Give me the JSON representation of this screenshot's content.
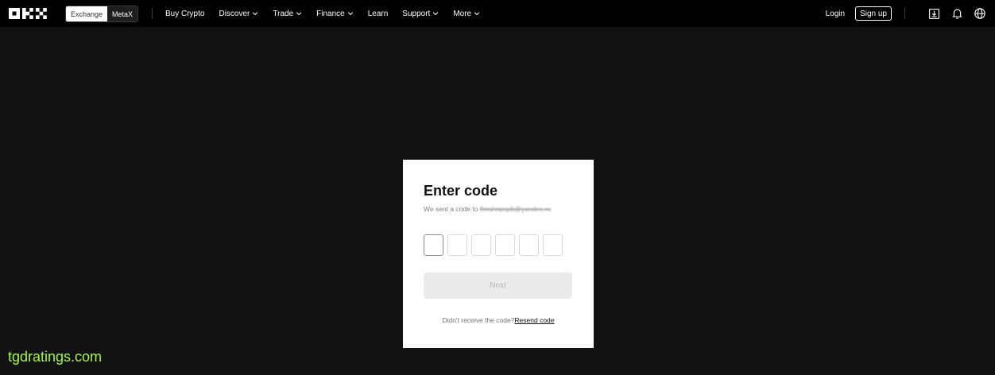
{
  "header": {
    "switcher": {
      "active_label": "Exchange",
      "inactive_label": "MetaX"
    },
    "nav": [
      {
        "label": "Buy Crypto",
        "has_dropdown": false
      },
      {
        "label": "Discover",
        "has_dropdown": true
      },
      {
        "label": "Trade",
        "has_dropdown": true
      },
      {
        "label": "Finance",
        "has_dropdown": true
      },
      {
        "label": "Learn",
        "has_dropdown": false
      },
      {
        "label": "Support",
        "has_dropdown": true
      },
      {
        "label": "More",
        "has_dropdown": true
      }
    ],
    "login_label": "Login",
    "signup_label": "Sign up",
    "icons": [
      "download-icon",
      "bell-icon",
      "globe-icon"
    ]
  },
  "modal": {
    "title": "Enter code",
    "subtitle_prefix": "We sent a code to ",
    "email": "flmshopspb@yandex.ru",
    "code_digits": [
      "",
      "",
      "",
      "",
      "",
      ""
    ],
    "next_label": "Next",
    "resend_prefix": "Didn't receive the code?",
    "resend_label": "Resend code"
  },
  "watermark": "tgdratings.com",
  "colors": {
    "background": "#121212",
    "topbar": "#000000",
    "card": "#ffffff",
    "watermark": "#a6f542"
  }
}
